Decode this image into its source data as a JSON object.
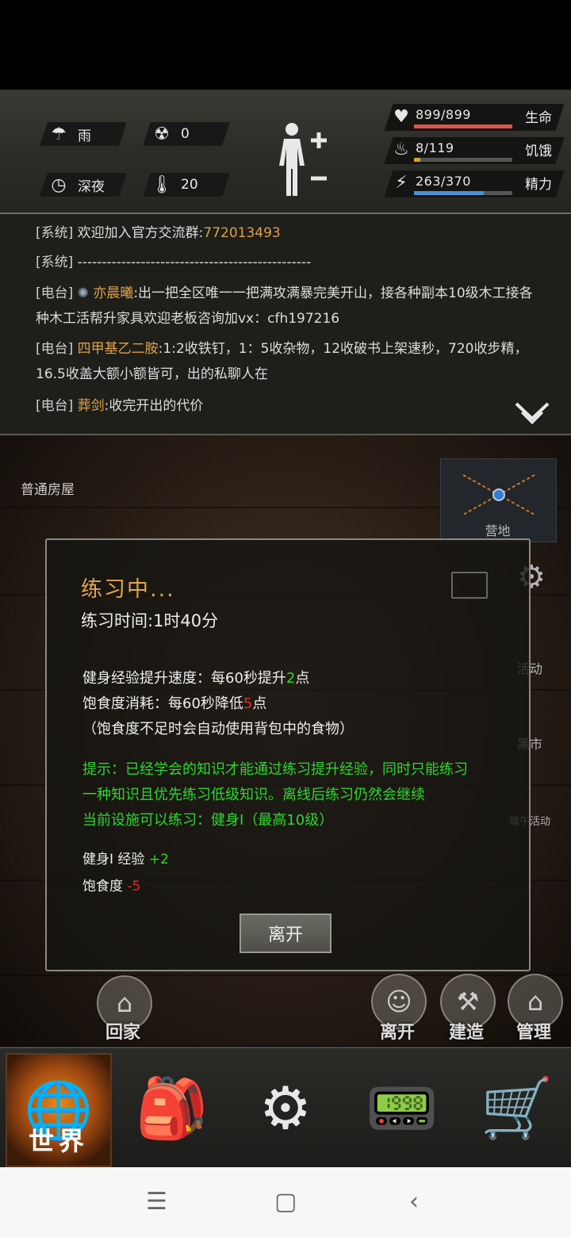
{
  "status": {
    "weather": "雨",
    "radiation": "0",
    "time_of_day": "深夜",
    "temperature": "20",
    "health": {
      "value": "899/899",
      "label": "生命",
      "fraction": 1.0,
      "color": "#d9564a"
    },
    "hunger": {
      "value": "8/119",
      "label": "饥饿",
      "fraction": 0.067,
      "color": "#d9a030"
    },
    "energy": {
      "value": "263/370",
      "label": "精力",
      "fraction": 0.71,
      "color": "#4a8fd8"
    }
  },
  "chat": [
    {
      "tag": "[系统]",
      "text": "欢迎加入官方交流群:",
      "highlight": "772013493"
    },
    {
      "tag": "[系统]",
      "text": "------------------------------------------------"
    },
    {
      "tag": "[电台]",
      "name": "亦晨曦",
      "text": ":出一把全区唯一一把满攻满暴完美开山，接各种副本10级木工接各种木工活帮升家具欢迎老板咨询加vx：cfh197216"
    },
    {
      "tag": "[电台]",
      "name": "四甲基乙二胺",
      "text": ":1:2收铁钉，1：5收杂物，12收破书上架速秒，720收步精，16.5收盖大额小额皆可，出的私聊人在"
    },
    {
      "tag": "[电台]",
      "name": "葬剑",
      "text": ":收完开出的代价"
    }
  ],
  "location": "普通房屋",
  "minimap_label": "营地",
  "side_buttons": [
    "活动",
    "黑市",
    "端午活动"
  ],
  "dialog": {
    "title": "练习中...",
    "time": "练习时间:1时40分",
    "exp_prefix": "健身经验提升速度：每60秒提升",
    "exp_num": "2",
    "exp_suffix": "点",
    "food_prefix": "饱食度消耗：每60秒降低",
    "food_num": "5",
    "food_suffix": "点",
    "note": "（饱食度不足时会自动使用背包中的食物）",
    "hint1": "提示：已经学会的知识才能通过练习提升经验，同时只能练习",
    "hint2": "一种知识且优先练习低级知识。离线后练习仍然会继续",
    "hint3": "当前设施可以练习：健身Ⅰ（最高10级）",
    "gain_label": "健身Ⅰ 经验",
    "gain_value": "+2",
    "loss_label": "饱食度",
    "loss_value": "-5",
    "leave": "离开"
  },
  "round_buttons": {
    "home": "回家",
    "leave": "离开",
    "build": "建造",
    "manage": "管理"
  },
  "nav": {
    "world": "世界"
  }
}
